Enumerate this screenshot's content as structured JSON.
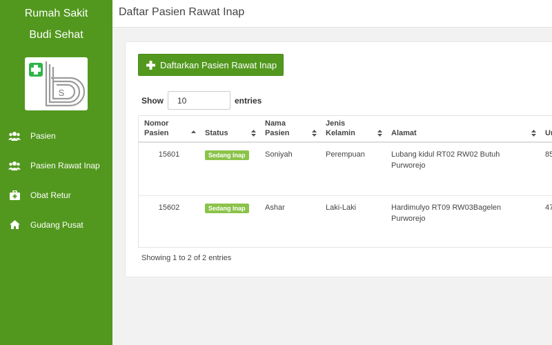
{
  "sidebar": {
    "brand_line1": "Rumah Sakit",
    "brand_line2": "Budi Sehat",
    "logo_icon": "hospital-bs-logo",
    "items": [
      {
        "label": "Pasien",
        "icon": "users-icon"
      },
      {
        "label": "Pasien Rawat Inap",
        "icon": "users-icon"
      },
      {
        "label": "Obat Retur",
        "icon": "medkit-icon"
      },
      {
        "label": "Gudang Pusat",
        "icon": "home-icon"
      }
    ]
  },
  "header": {
    "title": "Daftar Pasien Rawat Inap"
  },
  "main": {
    "add_button": "Daftarkan Pasien Rawat Inap",
    "length_show": "Show",
    "length_value": "10",
    "length_entries": "entries",
    "columns": [
      {
        "line1": "Nomor",
        "line2": "Pasien"
      },
      {
        "line1": "",
        "line2": "Status"
      },
      {
        "line1": "Nama",
        "line2": "Pasien"
      },
      {
        "line1": "Jenis",
        "line2": "Kelamin"
      },
      {
        "line1": "",
        "line2": "Alamat"
      },
      {
        "line1": "",
        "line2": "Ur"
      }
    ],
    "rows": [
      {
        "nomor": "15601",
        "status": "Sedang Inap",
        "nama": "Soniyah",
        "jenis": "Perempuan",
        "alamat": "Lubang kidul RT02 RW02 Butuh Purworejo",
        "extra": "85"
      },
      {
        "nomor": "15602",
        "status": "Sedang Inap",
        "nama": "Ashar",
        "jenis": "Laki-Laki",
        "alamat": "Hardimulyo RT09 RW03Bagelen Purworejo",
        "extra": "47"
      }
    ],
    "info": "Showing 1 to 2 of 2 entries"
  },
  "colors": {
    "sidebar": "#52981e",
    "badge": "#8bc34a"
  }
}
